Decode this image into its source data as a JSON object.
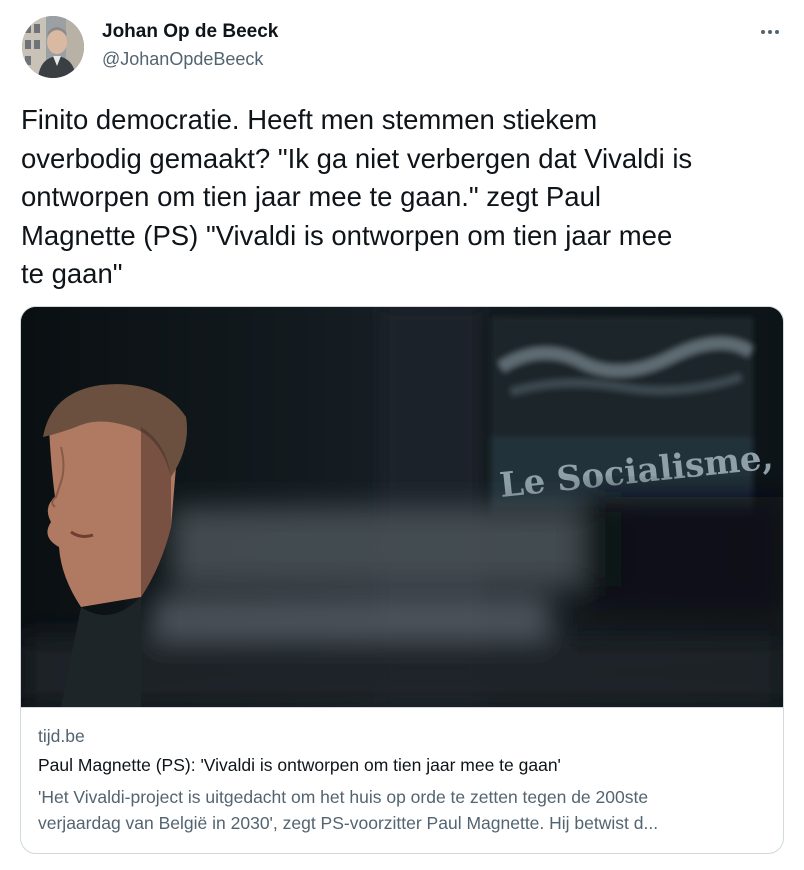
{
  "author": {
    "name": "Johan Op de Beeck",
    "handle": "@JohanOpdeBeeck",
    "avatar_icon": "profile-photo"
  },
  "more_icon": "more-horizontal-icon",
  "tweet_text_lines": [
    "Finito democratie. Heeft men stemmen stiekem",
    "overbodig gemaakt? \"Ik ga niet verbergen dat  Vivaldi is",
    "ontworpen om tien jaar mee te gaan.\" zegt Paul",
    "Magnette (PS) \"Vivaldi is ontworpen om tien jaar mee",
    "te gaan\""
  ],
  "link_card": {
    "image_sign_text": "Le Socialisme,",
    "domain": "tijd.be",
    "title": "Paul Magnette (PS): 'Vivaldi is ontworpen om tien jaar mee te gaan'",
    "description_lines": [
      "'Het Vivaldi-project is uitgedacht om het huis op orde te zetten tegen de 200ste",
      "verjaardag van België in 2030', zegt PS-voorzitter Paul Magnette. Hij betwist d..."
    ]
  },
  "colors": {
    "text_primary": "#0f1419",
    "text_secondary": "#536471",
    "border": "#cfd9de"
  }
}
